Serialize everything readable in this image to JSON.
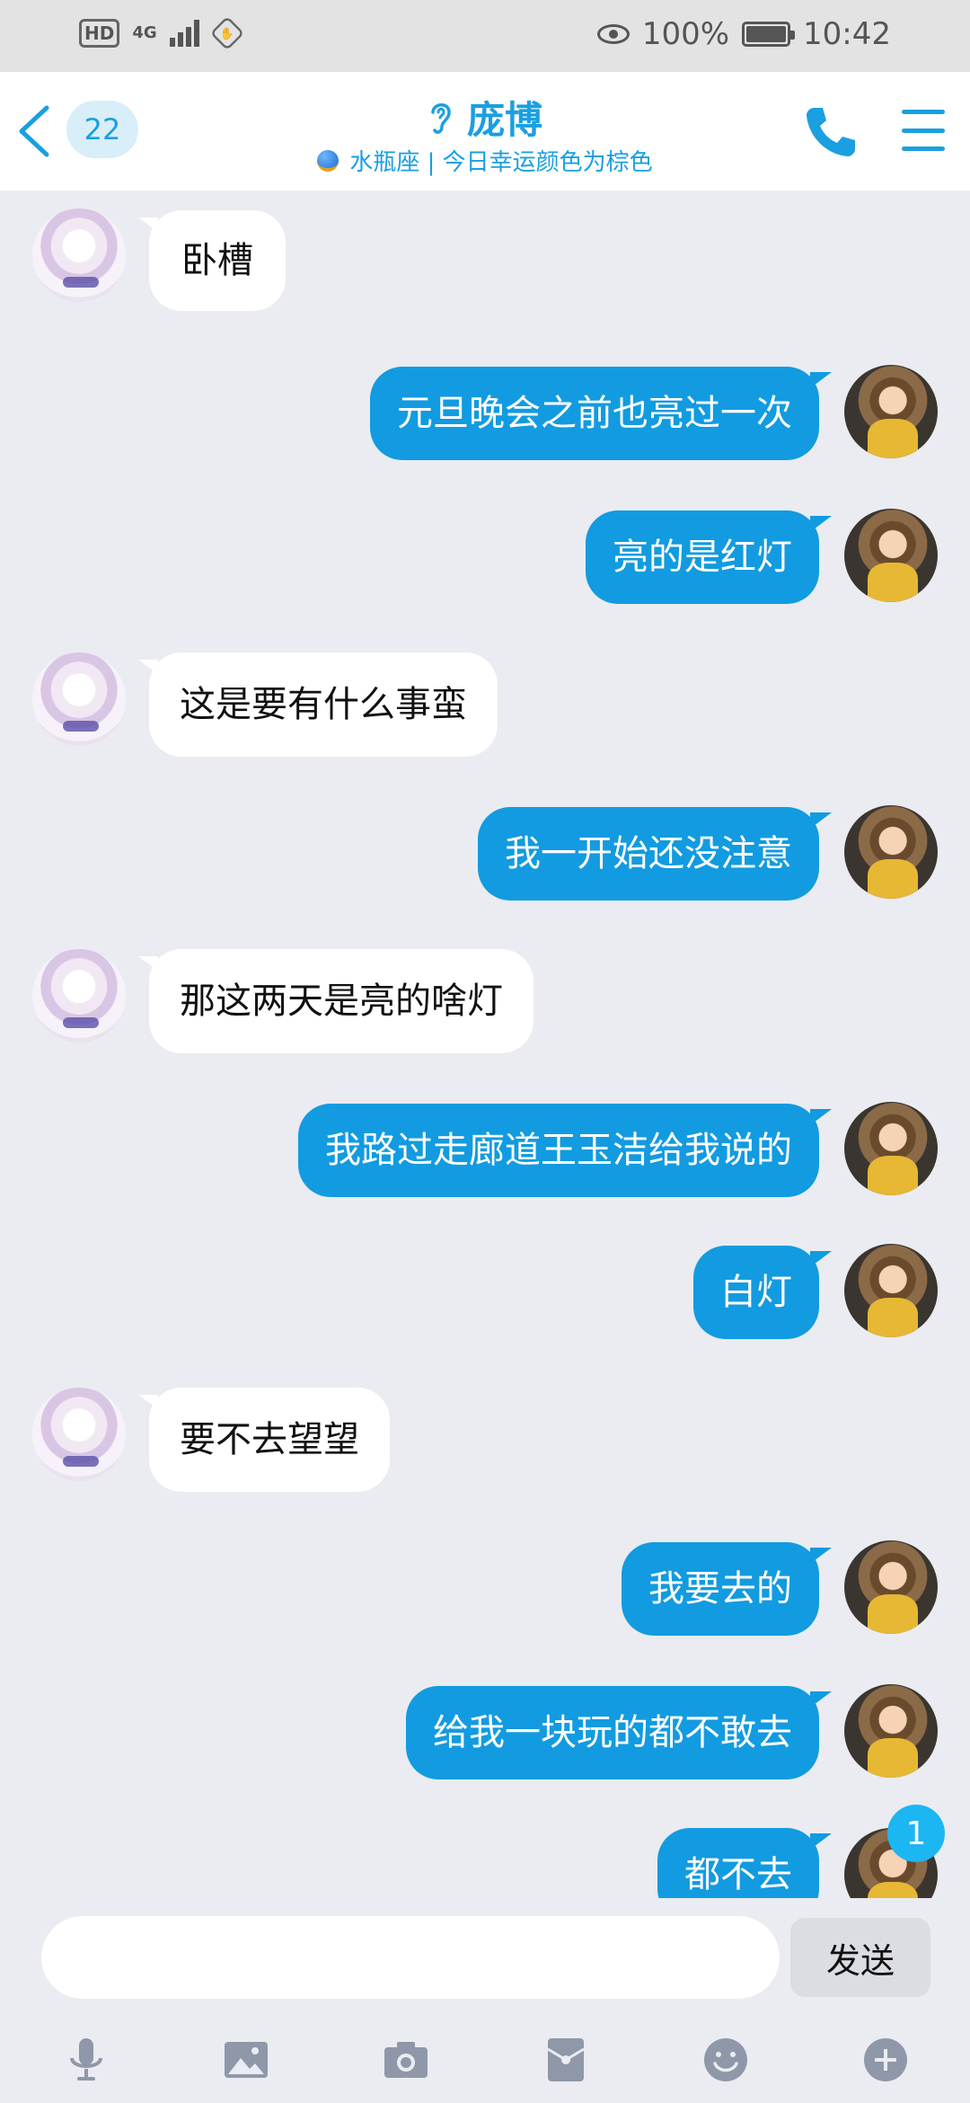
{
  "status_bar": {
    "hd": "HD",
    "network": "4G",
    "battery_percent": "100%",
    "time": "10:42"
  },
  "header": {
    "unread_count": "22",
    "contact_name": "庞博",
    "subtitle": "水瓶座 | 今日幸运颜色为棕色"
  },
  "messages": [
    {
      "side": "left",
      "text": "卧槽"
    },
    {
      "side": "right",
      "text": "元旦晚会之前也亮过一次"
    },
    {
      "side": "right",
      "text": "亮的是红灯"
    },
    {
      "side": "left",
      "text": "这是要有什么事蛮"
    },
    {
      "side": "right",
      "text": "我一开始还没注意"
    },
    {
      "side": "left",
      "text": "那这两天是亮的啥灯"
    },
    {
      "side": "right",
      "text": "我路过走廊道王玉洁给我说的"
    },
    {
      "side": "right",
      "text": "白灯"
    },
    {
      "side": "left",
      "text": "要不去望望"
    },
    {
      "side": "right",
      "text": "我要去的"
    },
    {
      "side": "right",
      "text": "给我一块玩的都不敢去"
    },
    {
      "side": "right",
      "text": "都不去"
    }
  ],
  "new_message_badge": "1",
  "input": {
    "value": "",
    "placeholder": "",
    "send_label": "发送"
  },
  "toolbar": {
    "icons": [
      "microphone-icon",
      "image-icon",
      "camera-icon",
      "red-packet-icon",
      "emoji-icon",
      "plus-icon"
    ]
  },
  "colors": {
    "accent": "#1a9fe0",
    "outgoing_bubble": "#129be0",
    "incoming_bubble": "#ffffff",
    "chat_background": "#eaecf1"
  }
}
